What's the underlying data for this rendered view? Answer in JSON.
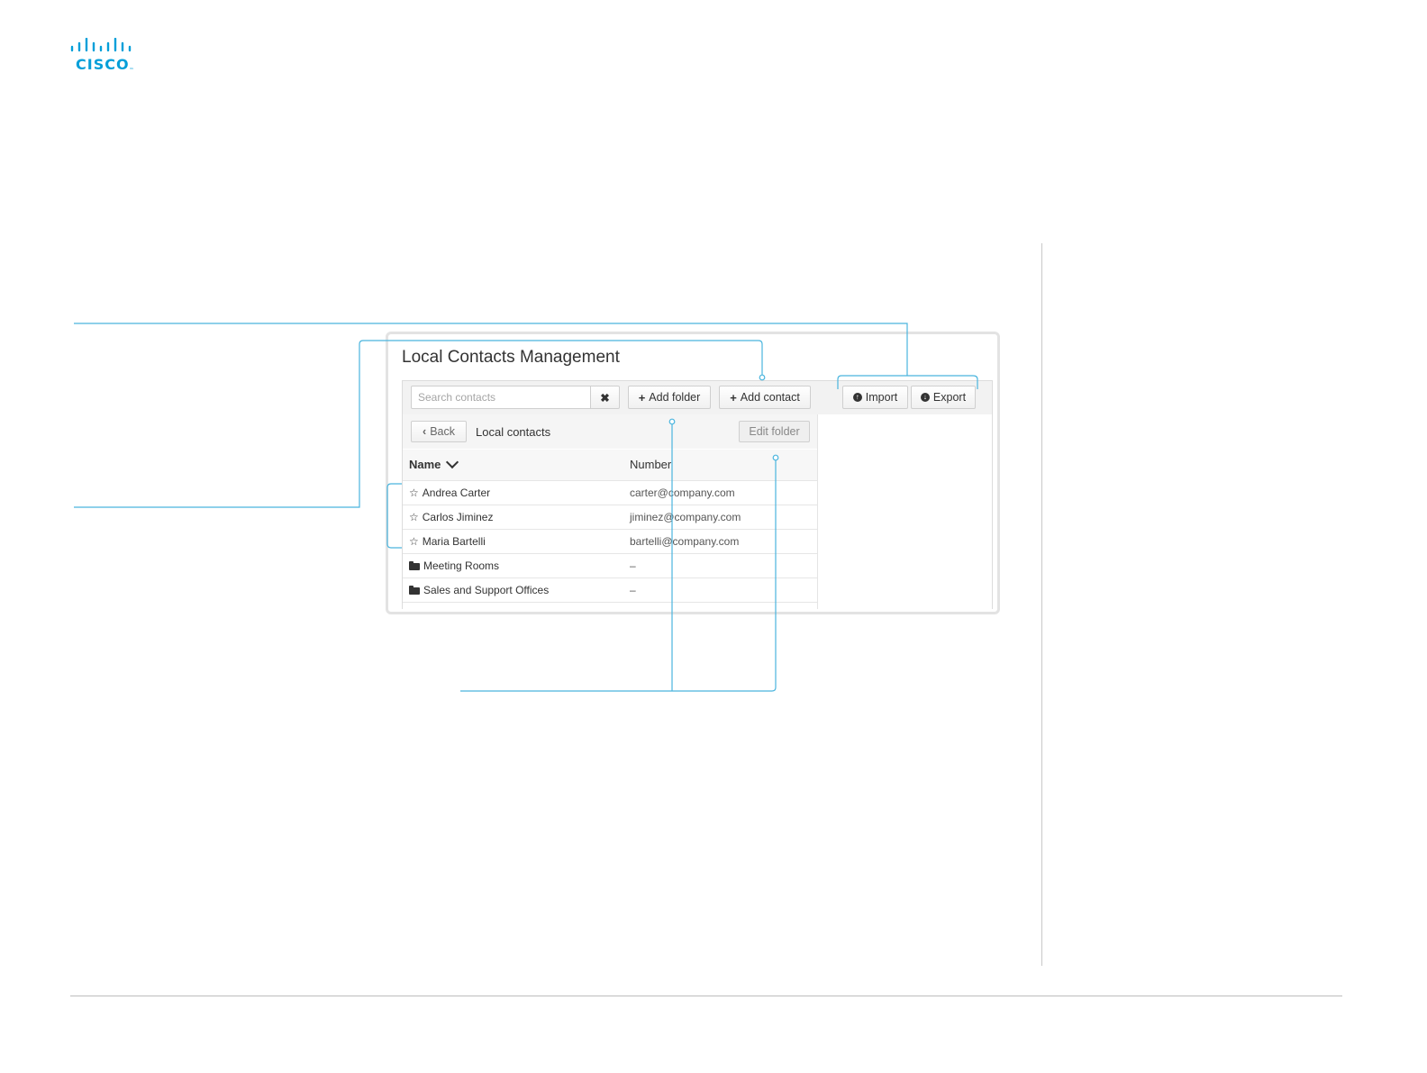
{
  "brand": {
    "logo_text": "CISCO",
    "accent": "#049fd9",
    "callout_color": "#4ab5de"
  },
  "window": {
    "title": "Local Contacts Management"
  },
  "toolbar": {
    "search_placeholder": "Search contacts",
    "clear_icon": "✖",
    "add_folder_label": "Add folder",
    "add_contact_label": "Add contact",
    "import_label": "Import",
    "export_label": "Export"
  },
  "nav": {
    "back_label": "Back",
    "breadcrumb": "Local contacts",
    "edit_folder_label": "Edit folder"
  },
  "table": {
    "columns": {
      "name": "Name",
      "number": "Number"
    },
    "rows": [
      {
        "type": "contact",
        "icon": "star-outline-icon",
        "name": "Andrea Carter",
        "number": "carter@company.com"
      },
      {
        "type": "contact",
        "icon": "star-outline-icon",
        "name": "Carlos Jiminez",
        "number": "jiminez@company.com"
      },
      {
        "type": "contact",
        "icon": "star-outline-icon",
        "name": "Maria Bartelli",
        "number": "bartelli@company.com"
      },
      {
        "type": "folder",
        "icon": "folder-open-icon",
        "name": "Meeting Rooms",
        "number": "–"
      },
      {
        "type": "folder",
        "icon": "folder-open-icon",
        "name": "Sales and Support Offices",
        "number": "–"
      }
    ]
  }
}
